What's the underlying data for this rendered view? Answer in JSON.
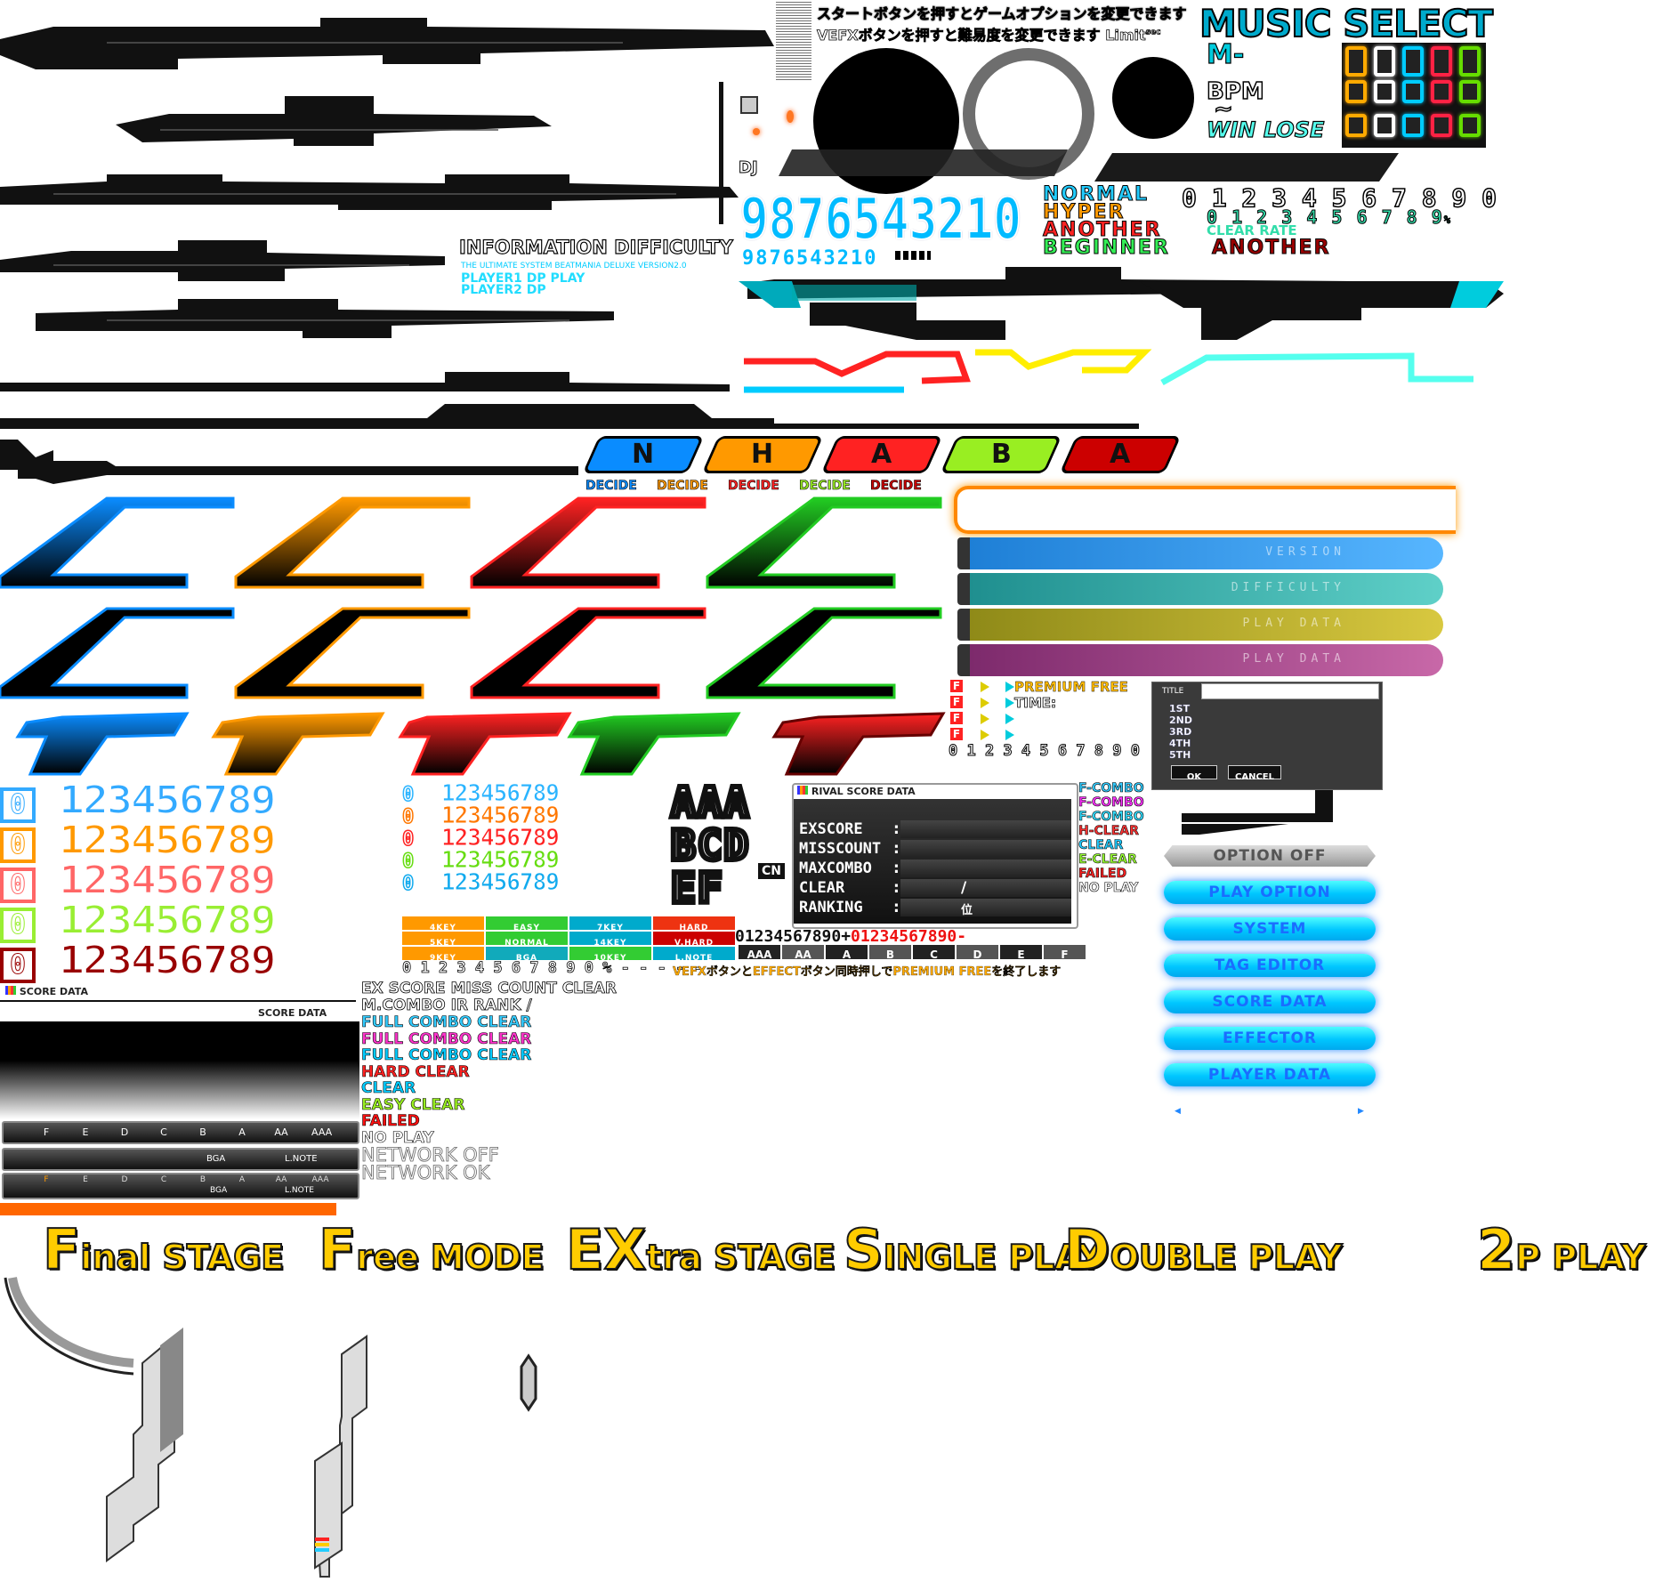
{
  "instructions": {
    "line1_prefix": "スタートボタンを押すと",
    "line1_highlight": "ゲームオプションを変更",
    "line1_suffix": "できます",
    "line2_prefix": "VEFXボタンを押すと",
    "line2_highlight": "難易度を変更",
    "line2_suffix": "できます",
    "limit": "Limit",
    "sec": "sec"
  },
  "music_select": {
    "title": "MUSIC SELECT",
    "m_prefix": "M-",
    "bpm": "BPM",
    "tilde": "~",
    "win": "WIN",
    "lose": "LOSE"
  },
  "dj_label": "DJ",
  "big_digits": "9876543210",
  "small_digits": "9876543210",
  "difficulty_names": {
    "normal": "NORMAL",
    "hyper": "HYPER",
    "another": "ANOTHER",
    "beginner": "BEGINNER",
    "another_dark": "ANOTHER",
    "clear_rate": "CLEAR RATE"
  },
  "outline_digits": "0 1 2 3 4 5 6 7 8 9 0",
  "green_digits": "0 1 2 3 4 5 6 7 8 9",
  "percent": "%",
  "information": {
    "info": "INFORMATION",
    "difficulty": "DIFFICULTY",
    "subtitle": "THE ULTIMATE SYSTEM BEATMANIA DELUXE VERSION2.0",
    "player1": "PLAYER1 DP PLAY",
    "player2": "PLAYER2 DP"
  },
  "diff_badges": [
    "N",
    "H",
    "A",
    "B",
    "A"
  ],
  "decide": [
    "DECIDE",
    "DECIDE",
    "DECIDE",
    "DECIDE",
    "DECIDE"
  ],
  "category_tabs": [
    "VERSION",
    "DIFFICULTY",
    "PLAY DATA",
    "PLAY DATA"
  ],
  "premium": {
    "premium_free": "PREMIUM FREE",
    "time": "TIME:",
    "digits": "0 1 2 3 4 5 6 7 8 9 0",
    "f_labels": [
      "F",
      "F",
      "F",
      "F"
    ]
  },
  "title_dialog": {
    "title_label": "TITLE",
    "ranks": [
      "1ST",
      "2ND",
      "3RD",
      "4TH",
      "5TH"
    ],
    "ok": "OK",
    "cancel": "CANCEL"
  },
  "number_rows_left": [
    {
      "zero": "0",
      "digits": "123456789",
      "color": "#33aaff"
    },
    {
      "zero": "0",
      "digits": "123456789",
      "color": "#ff9900"
    },
    {
      "zero": "0",
      "digits": "123456789",
      "color": "#ff6666"
    },
    {
      "zero": "0",
      "digits": "123456789",
      "color": "#99ee33"
    },
    {
      "zero": "0",
      "digits": "123456789",
      "color": "#990000"
    }
  ],
  "number_rows_mid": [
    {
      "zero": "0",
      "digits": "123456789",
      "color": "#2ab4ff"
    },
    {
      "zero": "0",
      "digits": "123456789",
      "color": "#ff7700"
    },
    {
      "zero": "0",
      "digits": "123456789",
      "color": "#ff2222"
    },
    {
      "zero": "0",
      "digits": "123456789",
      "color": "#66dd11"
    },
    {
      "zero": "0",
      "digits": "123456789",
      "color": "#11aaee"
    }
  ],
  "grade_letters": [
    "AAA",
    "BCD",
    "EF"
  ],
  "cn_label": "CN",
  "rival": {
    "header": "RIVAL SCORE DATA",
    "rows": [
      "EXSCORE",
      "MISSCOUNT",
      "MAXCOMBO",
      "CLEAR",
      "RANKING"
    ],
    "colon": ":",
    "slash": "/",
    "rank_unit": "位"
  },
  "lamp_small": [
    {
      "text": "F-COMBO",
      "color": "#33ccff"
    },
    {
      "text": "F-COMBO",
      "color": "#ff33ff"
    },
    {
      "text": "F-COMBO",
      "color": "#33ddff"
    },
    {
      "text": "H-CLEAR",
      "color": "#ff3333"
    },
    {
      "text": "CLEAR",
      "color": "#22ccff"
    },
    {
      "text": "E-CLEAR",
      "color": "#99ff33"
    },
    {
      "text": "FAILED",
      "color": "#ff2222"
    },
    {
      "text": "NO PLAY",
      "color": "#ffffff"
    }
  ],
  "mode_table": [
    [
      {
        "t": "4KEY",
        "c": "#ff9900"
      },
      {
        "t": "EASY",
        "c": "#33cc33"
      },
      {
        "t": "7KEY",
        "c": "#00aacc"
      },
      {
        "t": "HARD",
        "c": "#ee3311"
      }
    ],
    [
      {
        "t": "5KEY",
        "c": "#ff9900"
      },
      {
        "t": "NORMAL",
        "c": "#33cc33"
      },
      {
        "t": "14KEY",
        "c": "#00aacc"
      },
      {
        "t": "V.HARD",
        "c": "#cc0000"
      }
    ],
    [
      {
        "t": "9KEY",
        "c": "#ff9900"
      },
      {
        "t": "BGA",
        "c": "#11aabb"
      },
      {
        "t": "10KEY",
        "c": "#33cc33"
      },
      {
        "t": "L.NOTE",
        "c": "#00aacc"
      }
    ]
  ],
  "digits_line_black": "01234567890+",
  "digits_line_red": "01234567890-",
  "percent_line": "0 1 2 3 4 5 6 7 8 9 0 % - - - - -",
  "grade_strip": [
    "AAA",
    "AA",
    "A",
    "B",
    "C",
    "D",
    "E",
    "F"
  ],
  "vefx_notice": "VEFXボタンとEFFECTボタン同時押しでPREMIUM FREEを終了します",
  "option_menu": {
    "option_off": "OPTION OFF",
    "buttons": [
      "PLAY OPTION",
      "SYSTEM",
      "TAG EDITOR",
      "SCORE DATA",
      "EFFECTOR",
      "PLAYER DATA"
    ],
    "arrow_left": "◀",
    "arrow_right": "▶"
  },
  "score_data": {
    "header": "SCORE DATA",
    "sub": "SCORE DATA",
    "rank_bar": [
      "F",
      "E",
      "D",
      "C",
      "B",
      "A",
      "AA",
      "AAA"
    ],
    "bga": "BGA",
    "lnote": "L.NOTE"
  },
  "labels": {
    "ex_score": "EX SCORE",
    "miss_count": "MISS COUNT",
    "clear": "CLEAR",
    "m_combo": "M.COMBO",
    "ir_rank": "IR RANK",
    "slash": "/"
  },
  "lamp_big": [
    {
      "text": "FULL COMBO CLEAR",
      "color": "#33ccff"
    },
    {
      "text": "FULL COMBO CLEAR",
      "color": "#ff33cc"
    },
    {
      "text": "FULL COMBO CLEAR",
      "color": "#00ccff"
    },
    {
      "text": "HARD CLEAR",
      "color": "#ff2222"
    },
    {
      "text": "CLEAR",
      "color": "#00ccff"
    },
    {
      "text": "EASY CLEAR",
      "color": "#99ee22"
    },
    {
      "text": "FAILED",
      "color": "#ff1111"
    },
    {
      "text": "NO PLAY",
      "color": "#ffffff"
    }
  ],
  "network": {
    "off": "NETWORK OFF",
    "ok": "NETWORK OK"
  },
  "modes": [
    {
      "big": "F",
      "rest": "inal STAGE"
    },
    {
      "big": "F",
      "rest": "ree MODE"
    },
    {
      "big": "EX",
      "rest": "tra STAGE"
    },
    {
      "big": "S",
      "rest": "INGLE PLAY"
    },
    {
      "big": "D",
      "rest": "OUBLE PLAY"
    },
    {
      "big": "2",
      "rest": "P PLAY"
    }
  ],
  "colors": {
    "blue": "#0a8cff",
    "orange": "#ff9900",
    "red": "#ff2222",
    "green": "#22cc22",
    "cyan": "#00ccff",
    "yellow": "#ffcc00",
    "pink": "#cc3399"
  }
}
